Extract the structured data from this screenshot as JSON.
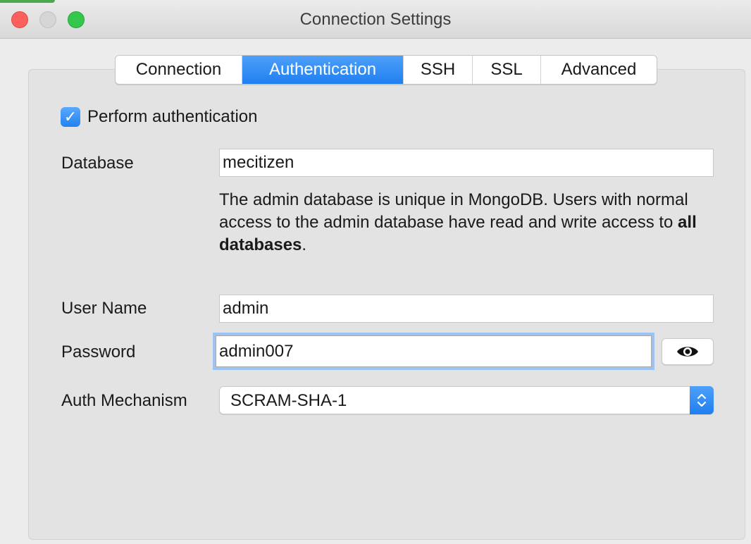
{
  "window": {
    "title": "Connection Settings"
  },
  "tabs": [
    {
      "label": "Connection"
    },
    {
      "label": "Authentication"
    },
    {
      "label": "SSH"
    },
    {
      "label": "SSL"
    },
    {
      "label": "Advanced"
    }
  ],
  "active_tab": "Authentication",
  "auth": {
    "perform_label": "Perform authentication",
    "perform_checked": true,
    "database_label": "Database",
    "database_value": "mecitizen",
    "help_text_part1": "The admin database is unique in MongoDB. Users with normal access to the admin database have read and write access to ",
    "help_text_bold": "all databases",
    "help_text_end": ".",
    "username_label": "User Name",
    "username_value": "admin",
    "password_label": "Password",
    "password_value": "admin007",
    "mechanism_label": "Auth Mechanism",
    "mechanism_value": "SCRAM-SHA-1"
  },
  "icons": {
    "show_password": "eye-icon",
    "checkbox": "checkmark-icon",
    "select": "chevron-up-down-icon"
  },
  "colors": {
    "accent": "#2182f2",
    "focus_ring": "#9cc3f3"
  }
}
